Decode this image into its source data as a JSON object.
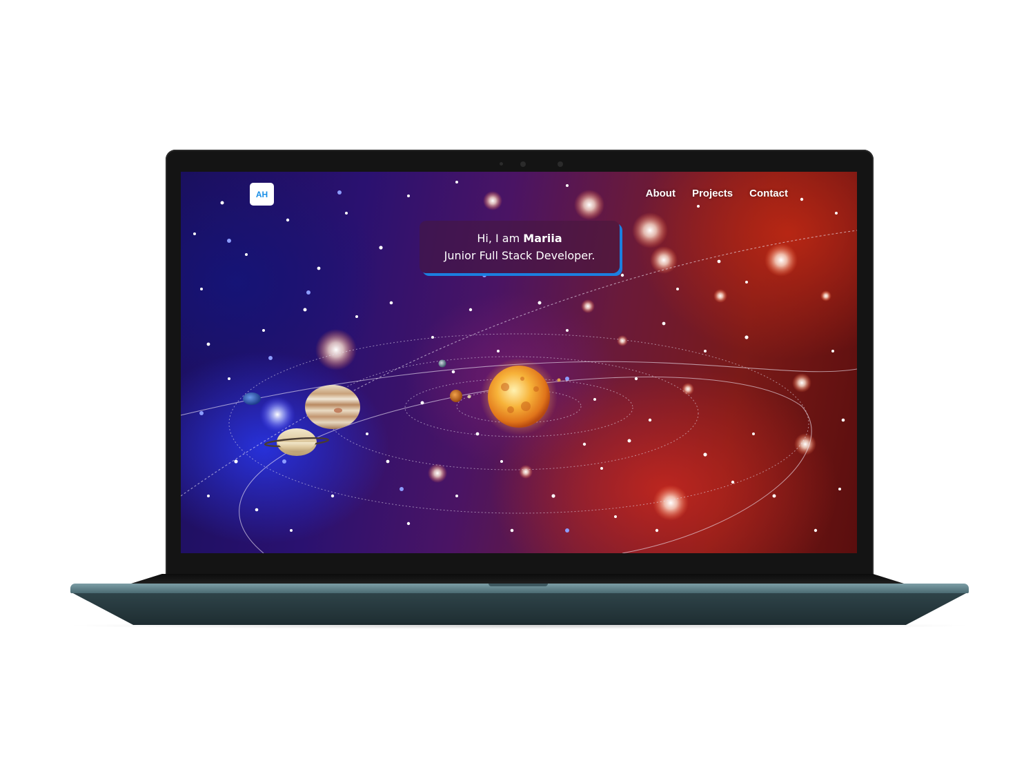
{
  "site": {
    "logo": "AH",
    "nav": [
      "About",
      "Projects",
      "Contact"
    ]
  },
  "hero": {
    "greeting": "Hi, I am",
    "name": "Mariia",
    "role": "Junior Full Stack Developer."
  },
  "colors": {
    "accent": "#1b7fe0",
    "logo_text": "#1a8fe6",
    "laptop_base": "#4b6a72",
    "bezel": "#141414"
  },
  "icons": [
    "webcam-icon"
  ]
}
